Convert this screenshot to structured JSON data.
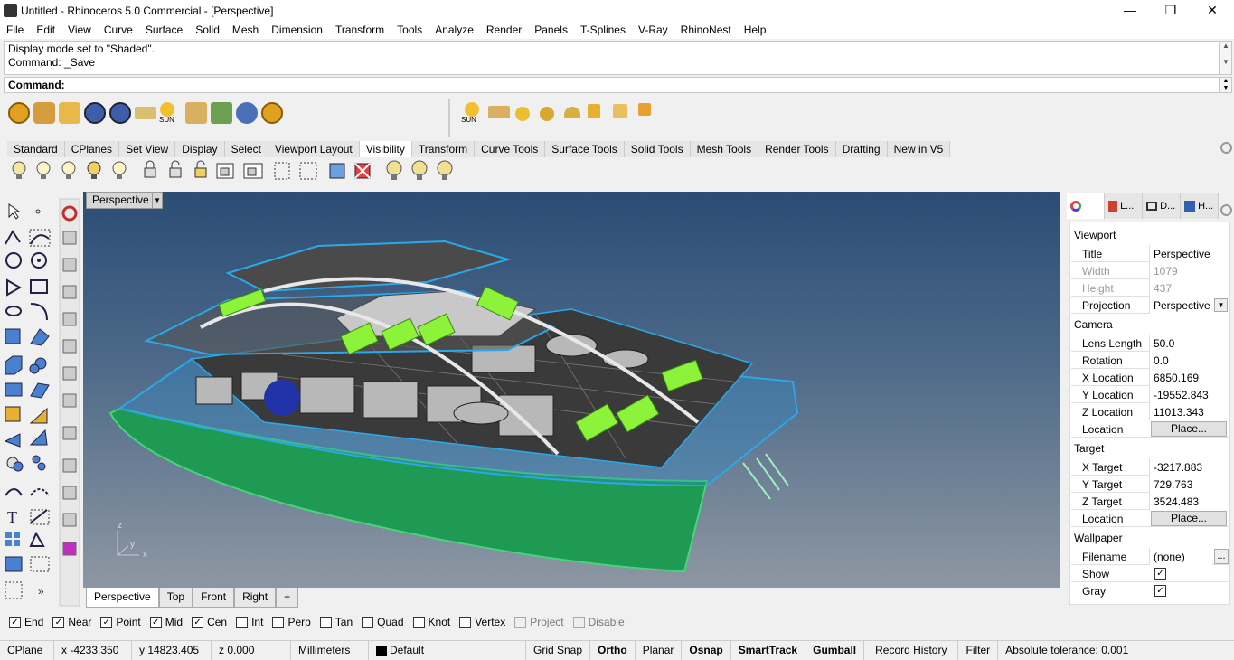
{
  "window": {
    "title": "Untitled - Rhinoceros 5.0 Commercial - [Perspective]",
    "minimize": "—",
    "restore": "❐",
    "close": "✕"
  },
  "menu": [
    "File",
    "Edit",
    "View",
    "Curve",
    "Surface",
    "Solid",
    "Mesh",
    "Dimension",
    "Transform",
    "Tools",
    "Analyze",
    "Render",
    "Panels",
    "T-Splines",
    "V-Ray",
    "RhinoNest",
    "Help"
  ],
  "command": {
    "history": [
      "Display mode set to \"Shaded\".",
      "Command: _Save"
    ],
    "prompt": "Command:"
  },
  "toolbar_tabs": [
    "Standard",
    "CPlanes",
    "Set View",
    "Display",
    "Select",
    "Viewport Layout",
    "Visibility",
    "Transform",
    "Curve Tools",
    "Surface Tools",
    "Solid Tools",
    "Mesh Tools",
    "Render Tools",
    "Drafting",
    "New in V5"
  ],
  "active_toolbar_tab": "Visibility",
  "toolbar_sun_label": "SUN",
  "viewport": {
    "name": "Perspective",
    "axes": {
      "x": "x",
      "y": "y",
      "z": "z"
    },
    "tabs": [
      "Perspective",
      "Top",
      "Front",
      "Right"
    ],
    "add_tab": "+"
  },
  "panel": {
    "tabs": [
      "L...",
      "D...",
      "H..."
    ],
    "sections": {
      "viewport": "Viewport",
      "camera": "Camera",
      "target": "Target",
      "wallpaper": "Wallpaper"
    },
    "viewport_props": {
      "title_label": "Title",
      "title": "Perspective",
      "width_label": "Width",
      "width": "1079",
      "height_label": "Height",
      "height": "437",
      "projection_label": "Projection",
      "projection": "Perspective"
    },
    "camera_props": {
      "lens_label": "Lens Length",
      "lens": "50.0",
      "rotation_label": "Rotation",
      "rotation": "0.0",
      "x_label": "X Location",
      "x": "6850.169",
      "y_label": "Y Location",
      "y": "-19552.843",
      "z_label": "Z Location",
      "z": "11013.343",
      "loc_label": "Location",
      "place": "Place..."
    },
    "target_props": {
      "x_label": "X Target",
      "x": "-3217.883",
      "y_label": "Y Target",
      "y": "729.763",
      "z_label": "Z Target",
      "z": "3524.483",
      "loc_label": "Location",
      "place": "Place..."
    },
    "wallpaper_props": {
      "filename_label": "Filename",
      "filename": "(none)",
      "browse": "...",
      "show_label": "Show",
      "show": true,
      "gray_label": "Gray",
      "gray": true
    }
  },
  "osnaps": [
    {
      "label": "End",
      "checked": true
    },
    {
      "label": "Near",
      "checked": true
    },
    {
      "label": "Point",
      "checked": true
    },
    {
      "label": "Mid",
      "checked": true
    },
    {
      "label": "Cen",
      "checked": true
    },
    {
      "label": "Int",
      "checked": false
    },
    {
      "label": "Perp",
      "checked": false
    },
    {
      "label": "Tan",
      "checked": false
    },
    {
      "label": "Quad",
      "checked": false
    },
    {
      "label": "Knot",
      "checked": false
    },
    {
      "label": "Vertex",
      "checked": false
    },
    {
      "label": "Project",
      "checked": false,
      "disabled": true
    },
    {
      "label": "Disable",
      "checked": false,
      "disabled": true
    }
  ],
  "status": {
    "cplane": "CPlane",
    "x": "x -4233.350",
    "y": "y 14823.405",
    "z": "z 0.000",
    "units": "Millimeters",
    "layer": "Default",
    "grid_snap": "Grid Snap",
    "ortho": "Ortho",
    "planar": "Planar",
    "osnap": "Osnap",
    "smarttrack": "SmartTrack",
    "gumball": "Gumball",
    "record_history": "Record History",
    "filter": "Filter",
    "tolerance": "Absolute tolerance: 0.001"
  },
  "colors": {
    "hull_green": "#1f9a55",
    "wire_blue": "#2aa8e8",
    "deck_dark": "#3a3a3a",
    "lounger_green": "#8cf23a",
    "keel_red": "#d0284a",
    "sky_top": "#2b4c75",
    "sky_bottom": "#8d97a3"
  }
}
